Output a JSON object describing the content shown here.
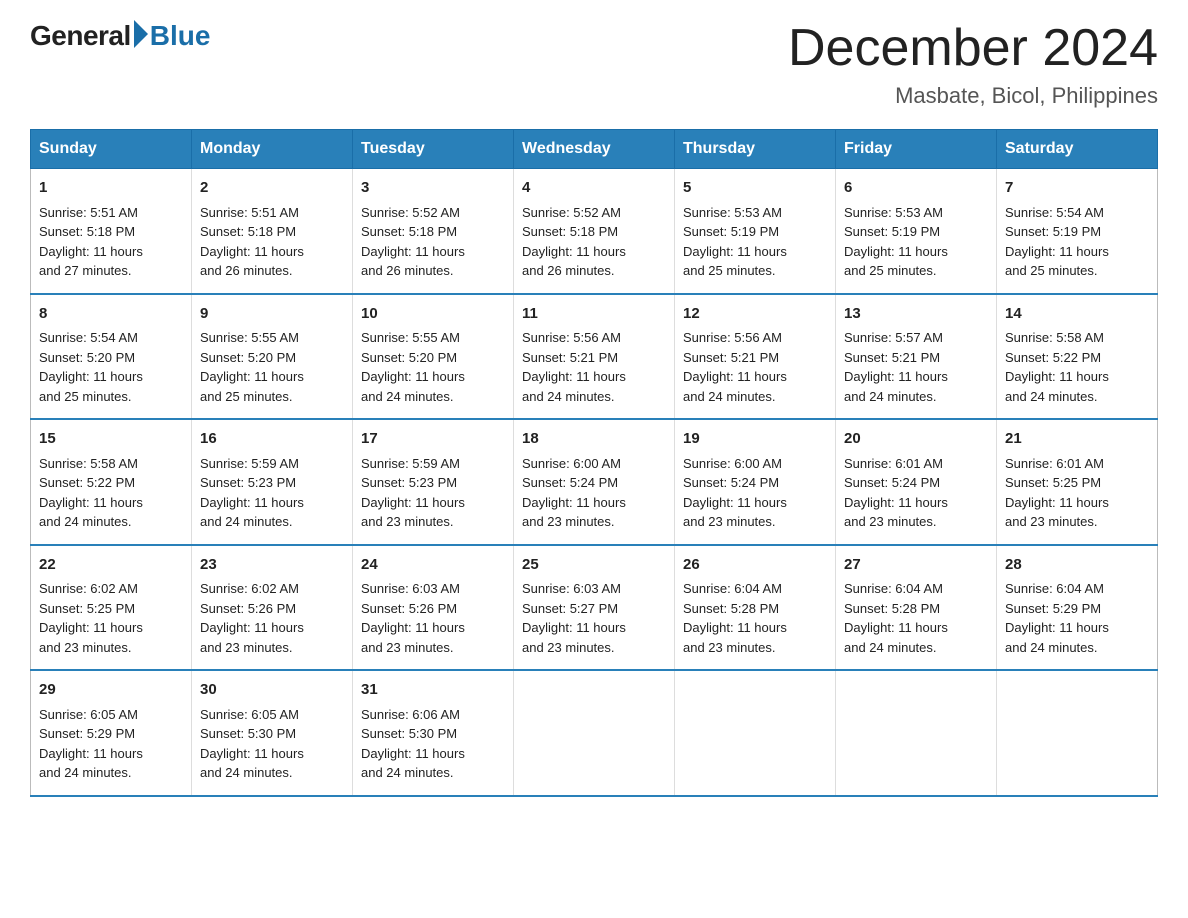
{
  "logo": {
    "general": "General",
    "blue": "Blue"
  },
  "header": {
    "month_year": "December 2024",
    "location": "Masbate, Bicol, Philippines"
  },
  "weekdays": [
    "Sunday",
    "Monday",
    "Tuesday",
    "Wednesday",
    "Thursday",
    "Friday",
    "Saturday"
  ],
  "weeks": [
    [
      {
        "day": "1",
        "sunrise": "5:51 AM",
        "sunset": "5:18 PM",
        "daylight": "11 hours and 27 minutes."
      },
      {
        "day": "2",
        "sunrise": "5:51 AM",
        "sunset": "5:18 PM",
        "daylight": "11 hours and 26 minutes."
      },
      {
        "day": "3",
        "sunrise": "5:52 AM",
        "sunset": "5:18 PM",
        "daylight": "11 hours and 26 minutes."
      },
      {
        "day": "4",
        "sunrise": "5:52 AM",
        "sunset": "5:18 PM",
        "daylight": "11 hours and 26 minutes."
      },
      {
        "day": "5",
        "sunrise": "5:53 AM",
        "sunset": "5:19 PM",
        "daylight": "11 hours and 25 minutes."
      },
      {
        "day": "6",
        "sunrise": "5:53 AM",
        "sunset": "5:19 PM",
        "daylight": "11 hours and 25 minutes."
      },
      {
        "day": "7",
        "sunrise": "5:54 AM",
        "sunset": "5:19 PM",
        "daylight": "11 hours and 25 minutes."
      }
    ],
    [
      {
        "day": "8",
        "sunrise": "5:54 AM",
        "sunset": "5:20 PM",
        "daylight": "11 hours and 25 minutes."
      },
      {
        "day": "9",
        "sunrise": "5:55 AM",
        "sunset": "5:20 PM",
        "daylight": "11 hours and 25 minutes."
      },
      {
        "day": "10",
        "sunrise": "5:55 AM",
        "sunset": "5:20 PM",
        "daylight": "11 hours and 24 minutes."
      },
      {
        "day": "11",
        "sunrise": "5:56 AM",
        "sunset": "5:21 PM",
        "daylight": "11 hours and 24 minutes."
      },
      {
        "day": "12",
        "sunrise": "5:56 AM",
        "sunset": "5:21 PM",
        "daylight": "11 hours and 24 minutes."
      },
      {
        "day": "13",
        "sunrise": "5:57 AM",
        "sunset": "5:21 PM",
        "daylight": "11 hours and 24 minutes."
      },
      {
        "day": "14",
        "sunrise": "5:58 AM",
        "sunset": "5:22 PM",
        "daylight": "11 hours and 24 minutes."
      }
    ],
    [
      {
        "day": "15",
        "sunrise": "5:58 AM",
        "sunset": "5:22 PM",
        "daylight": "11 hours and 24 minutes."
      },
      {
        "day": "16",
        "sunrise": "5:59 AM",
        "sunset": "5:23 PM",
        "daylight": "11 hours and 24 minutes."
      },
      {
        "day": "17",
        "sunrise": "5:59 AM",
        "sunset": "5:23 PM",
        "daylight": "11 hours and 23 minutes."
      },
      {
        "day": "18",
        "sunrise": "6:00 AM",
        "sunset": "5:24 PM",
        "daylight": "11 hours and 23 minutes."
      },
      {
        "day": "19",
        "sunrise": "6:00 AM",
        "sunset": "5:24 PM",
        "daylight": "11 hours and 23 minutes."
      },
      {
        "day": "20",
        "sunrise": "6:01 AM",
        "sunset": "5:24 PM",
        "daylight": "11 hours and 23 minutes."
      },
      {
        "day": "21",
        "sunrise": "6:01 AM",
        "sunset": "5:25 PM",
        "daylight": "11 hours and 23 minutes."
      }
    ],
    [
      {
        "day": "22",
        "sunrise": "6:02 AM",
        "sunset": "5:25 PM",
        "daylight": "11 hours and 23 minutes."
      },
      {
        "day": "23",
        "sunrise": "6:02 AM",
        "sunset": "5:26 PM",
        "daylight": "11 hours and 23 minutes."
      },
      {
        "day": "24",
        "sunrise": "6:03 AM",
        "sunset": "5:26 PM",
        "daylight": "11 hours and 23 minutes."
      },
      {
        "day": "25",
        "sunrise": "6:03 AM",
        "sunset": "5:27 PM",
        "daylight": "11 hours and 23 minutes."
      },
      {
        "day": "26",
        "sunrise": "6:04 AM",
        "sunset": "5:28 PM",
        "daylight": "11 hours and 23 minutes."
      },
      {
        "day": "27",
        "sunrise": "6:04 AM",
        "sunset": "5:28 PM",
        "daylight": "11 hours and 24 minutes."
      },
      {
        "day": "28",
        "sunrise": "6:04 AM",
        "sunset": "5:29 PM",
        "daylight": "11 hours and 24 minutes."
      }
    ],
    [
      {
        "day": "29",
        "sunrise": "6:05 AM",
        "sunset": "5:29 PM",
        "daylight": "11 hours and 24 minutes."
      },
      {
        "day": "30",
        "sunrise": "6:05 AM",
        "sunset": "5:30 PM",
        "daylight": "11 hours and 24 minutes."
      },
      {
        "day": "31",
        "sunrise": "6:06 AM",
        "sunset": "5:30 PM",
        "daylight": "11 hours and 24 minutes."
      },
      null,
      null,
      null,
      null
    ]
  ],
  "labels": {
    "sunrise": "Sunrise:",
    "sunset": "Sunset:",
    "daylight": "Daylight:"
  }
}
